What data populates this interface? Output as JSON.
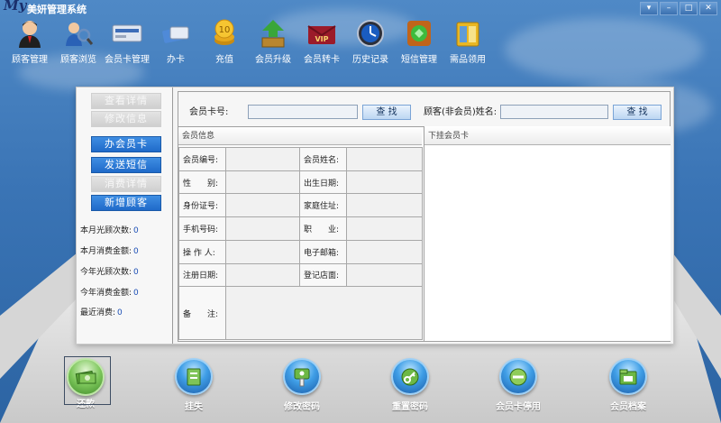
{
  "window": {
    "logo": "My",
    "title": "美妍管理系统",
    "controls": [
      "▾",
      "–",
      "□",
      "✕"
    ]
  },
  "toolbar": {
    "items": [
      {
        "label": "顾客管理",
        "icon": "customer-icon"
      },
      {
        "label": "顾客浏览",
        "icon": "browse-icon"
      },
      {
        "label": "会员卡管理",
        "icon": "card-icon"
      },
      {
        "label": "办卡",
        "icon": "issue-card-icon"
      },
      {
        "label": "充值",
        "icon": "coin-icon"
      },
      {
        "label": "会员升级",
        "icon": "upgrade-icon"
      },
      {
        "label": "会员转卡",
        "icon": "vip-transfer-icon"
      },
      {
        "label": "历史记录",
        "icon": "history-icon"
      },
      {
        "label": "短信管理",
        "icon": "sms-icon"
      },
      {
        "label": "需品领用",
        "icon": "supplies-icon"
      }
    ]
  },
  "left": {
    "buttons": [
      {
        "label": "查看详情",
        "state": "disabled"
      },
      {
        "label": "修改信息",
        "state": "disabled"
      },
      {
        "label": "办会员卡",
        "state": "active"
      },
      {
        "label": "发送短信",
        "state": "active"
      },
      {
        "label": "消费详情",
        "state": "disabled"
      },
      {
        "label": "新增顾客",
        "state": "active"
      }
    ],
    "stats": [
      {
        "label": "本月光顾次数:",
        "value": "0"
      },
      {
        "label": "本月消费金额:",
        "value": "0"
      },
      {
        "label": "今年光顾次数:",
        "value": "0"
      },
      {
        "label": "今年消费金额:",
        "value": "0"
      },
      {
        "label": "最近消费:",
        "value": "0"
      }
    ]
  },
  "search": {
    "card_label": "会员卡号:",
    "card_value": "",
    "name_label": "顾客(非会员)姓名:",
    "name_value": "",
    "button_label": "查 找"
  },
  "member_info": {
    "header": "会员信息",
    "rows": [
      [
        "会员编号:",
        "",
        "会员姓名:",
        ""
      ],
      [
        "性　　别:",
        "",
        "出生日期:",
        ""
      ],
      [
        "身份证号:",
        "",
        "家庭住址:",
        ""
      ],
      [
        "手机号码:",
        "",
        "职　　业:",
        ""
      ],
      [
        "操 作 人:",
        "",
        "电子邮箱:",
        ""
      ],
      [
        "注册日期:",
        "",
        "登记店面:",
        ""
      ]
    ],
    "remark_label": "备　　注:"
  },
  "sub_cards": {
    "header": "下挂会员卡"
  },
  "bottom": {
    "buttons": [
      {
        "label": "还款",
        "icon": "repay-icon",
        "selected": true
      },
      {
        "label": "挂失",
        "icon": "report-loss-icon",
        "selected": false
      },
      {
        "label": "修改密码",
        "icon": "change-password-icon",
        "selected": false
      },
      {
        "label": "重置密码",
        "icon": "reset-password-icon",
        "selected": false
      },
      {
        "label": "会员卡停用",
        "icon": "disable-card-icon",
        "selected": false
      },
      {
        "label": "会员档案",
        "icon": "member-file-icon",
        "selected": false
      }
    ]
  },
  "colors": {
    "accent": "#1f6ac9",
    "sky": "#3a74b5",
    "stat_value": "#1c4fb5"
  }
}
